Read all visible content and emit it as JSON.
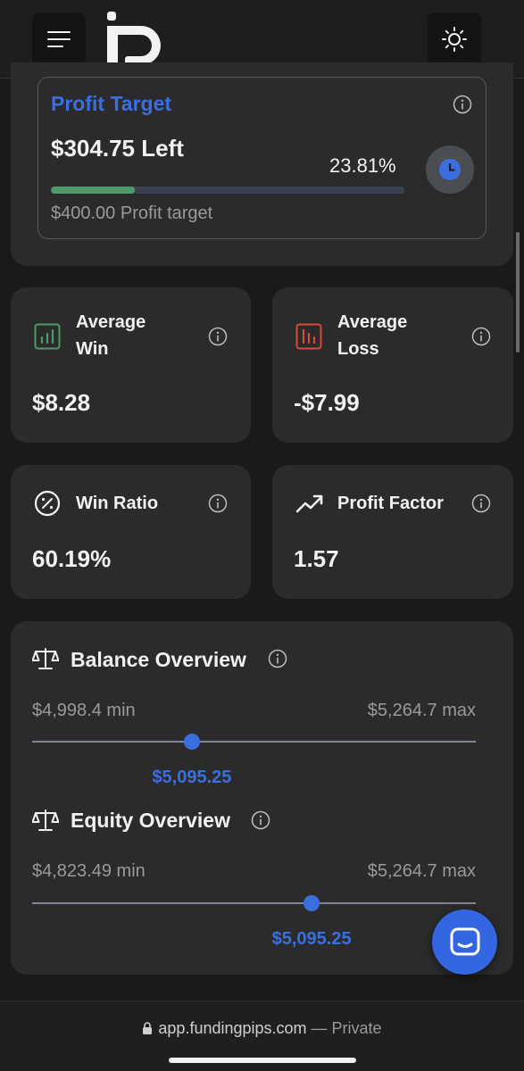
{
  "header": {
    "menu_icon": "hamburger-icon",
    "logo": "fundingpips-logo",
    "theme_icon": "sun-icon"
  },
  "profit_target": {
    "title": "Profit Target",
    "left": "$304.75 Left",
    "percent": "23.81%",
    "progress": 0.2381,
    "target": "$400.00 Profit target",
    "accent": "#3b6fe0",
    "bar_color": "#4f9a6b"
  },
  "stats": {
    "avg_win": {
      "label_line1": "Average",
      "label_line2": "Win",
      "value": "$8.28",
      "icon": "bar-chart-up-icon",
      "color": "#4f9a6b"
    },
    "avg_loss": {
      "label_line1": "Average",
      "label_line2": "Loss",
      "value": "-$7.99",
      "icon": "bar-chart-down-icon",
      "color": "#d84a3a"
    },
    "win_ratio": {
      "label": "Win Ratio",
      "value": "60.19%",
      "icon": "percent-circle-icon"
    },
    "profit_factor": {
      "label": "Profit Factor",
      "value": "1.57",
      "icon": "trending-up-icon"
    }
  },
  "balance": {
    "title": "Balance Overview",
    "min": "$4,998.4 min",
    "max": "$5,264.7 max",
    "value": "$5,095.25",
    "position": 0.36
  },
  "equity": {
    "title": "Equity Overview",
    "min": "$4,823.49 min",
    "max": "$5,264.7 max",
    "value": "$5,095.25",
    "position": 0.63
  },
  "browser": {
    "domain": "app.fundingpips.com",
    "privacy": "— Private"
  }
}
